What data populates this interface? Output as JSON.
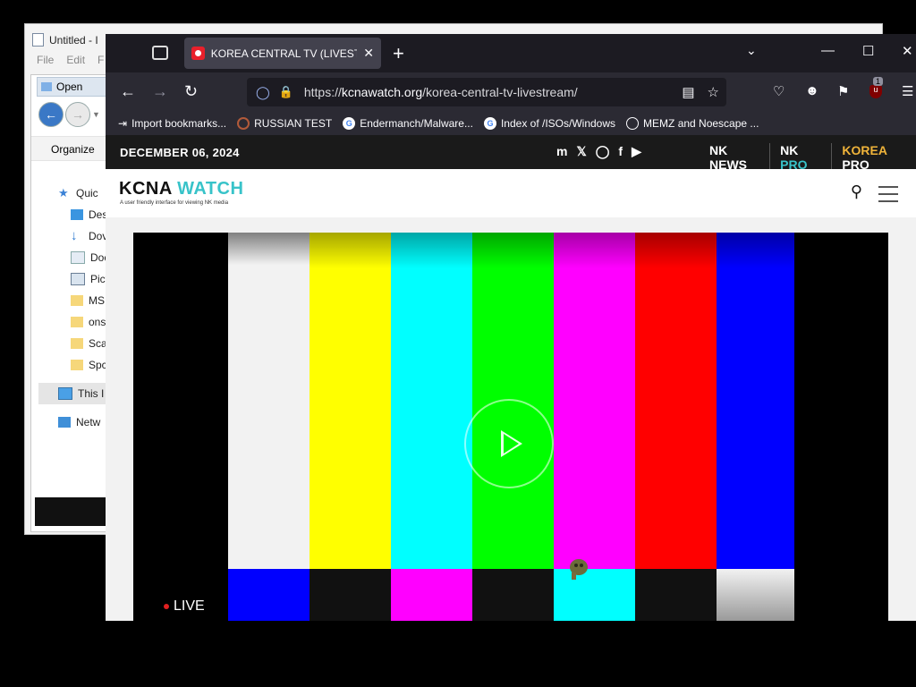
{
  "notepad": {
    "title": "Untitled - I",
    "menu": [
      "File",
      "Edit",
      "F"
    ]
  },
  "open_dialog": {
    "title": "Open",
    "organize": "Organize",
    "tree": [
      {
        "label": "Quic",
        "icon": "star-icon"
      },
      {
        "label": "Des",
        "icon": "desktop-icon"
      },
      {
        "label": "Dov",
        "icon": "download-icon"
      },
      {
        "label": "Doc",
        "icon": "documents-icon"
      },
      {
        "label": "Pict",
        "icon": "pictures-icon"
      },
      {
        "label": "MS",
        "icon": "folder-icon"
      },
      {
        "label": "ons",
        "icon": "folder-icon"
      },
      {
        "label": "Sca",
        "icon": "folder-icon"
      },
      {
        "label": "Spc",
        "icon": "folder-icon"
      },
      {
        "label": "This I",
        "icon": "computer-icon"
      },
      {
        "label": "Netw",
        "icon": "network-icon"
      }
    ]
  },
  "browser": {
    "tab_title": "KOREA CENTRAL TV (LIVESTREAM)",
    "url_prefix": "https://",
    "url_host": "kcnawatch.org",
    "url_path": "/korea-central-tv-livestream/",
    "extension_badge": "1",
    "bookmarks": [
      {
        "label": "Import bookmarks...",
        "icon": "import-icon"
      },
      {
        "label": "RUSSIAN TEST",
        "icon": "ring-icon"
      },
      {
        "label": "Endermanch/Malware...",
        "icon": "google-icon"
      },
      {
        "label": "Index of /ISOs/Windows",
        "icon": "google-icon"
      },
      {
        "label": "MEMZ and Noescape ...",
        "icon": "globe-icon"
      }
    ]
  },
  "site": {
    "date": "DECEMBER 06, 2024",
    "partners": {
      "nknews": "NK NEWS",
      "nkpro_a": "NK ",
      "nkpro_b": "PRO",
      "kpro_a": "KOREA ",
      "kpro_b": "PRO"
    },
    "logo_a": "KCNA ",
    "logo_b": "WATCH",
    "tagline": "A user friendly interface for viewing NK media",
    "live_label": "LIVE",
    "colors": {
      "accent": "#38c3c9",
      "korea_pro": "#f0b43a"
    }
  },
  "test_card": {
    "top_bars": [
      "#000000",
      "#f2f2f2",
      "#ffff00",
      "#00ffff",
      "#00ff00",
      "#ff00ff",
      "#ff0000",
      "#0000ff",
      "#000000"
    ],
    "bottom_bars": [
      "#000000",
      "#0000ff",
      "#111111",
      "#ff00ff",
      "#111111",
      "#00ffff",
      "#111111",
      "#f2f2f2",
      "#000000"
    ]
  }
}
